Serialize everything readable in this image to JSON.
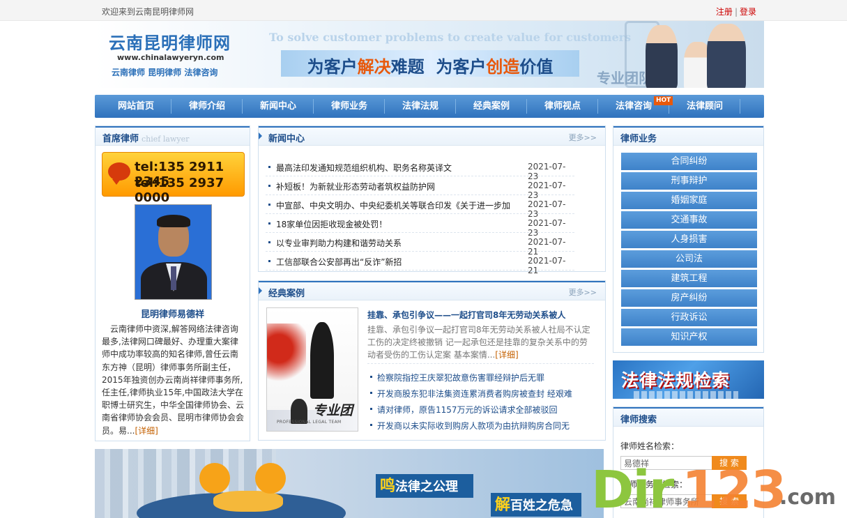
{
  "topbar": {
    "welcome": "欢迎来到云南昆明律师网",
    "register": "注册",
    "separator": "|",
    "login": "登录"
  },
  "banner": {
    "site_name": "云南昆明律师网",
    "site_url": "www.chinalawyeryn.com",
    "tags": "云南律师  昆明律师  法律咨询",
    "slogan_en": "To solve customer problems to create value for customers",
    "slogan_cn_parts": [
      "为客户",
      "解决",
      "难题",
      "为客户",
      "创造",
      "价值"
    ],
    "team_text": "专业团队"
  },
  "nav": {
    "items": [
      "网站首页",
      "律师介绍",
      "新闻中心",
      "律师业务",
      "法律法规",
      "经典案例",
      "律师视点",
      "法律咨询",
      "法律顾问"
    ],
    "hot_badge": "HOT"
  },
  "chief_lawyer": {
    "title": "首席律师",
    "subtitle": "chief lawyer",
    "phone1": "tel:135 2911 2345",
    "phone2": "tel:135 2937 0000",
    "name": "昆明律师易德祥",
    "bio": "云南律师中资深,解答网络法律咨询最多,法律网口碑最好、办理重大案律师中成功率较高的知名律师,曾任云南东方神（昆明）律师事务所副主任，2015年独资创办云南尚祥律师事务所,任主任,律师执业15年,中国政法大学在职博士研究生，中华全国律师协会、云南省律师协会会员、昆明市律师协会会员。易...",
    "detail_link": "[详细]"
  },
  "news": {
    "title": "新闻中心",
    "more": "更多>>",
    "items": [
      {
        "title": "最高法印发通知规范组织机构、职务名称英译文",
        "date": "2021-07-23"
      },
      {
        "title": "补短板！为新就业形态劳动者筑权益防护网",
        "date": "2021-07-23"
      },
      {
        "title": "中宣部、中央文明办、中央纪委机关等联合印发《关于进一步加",
        "date": "2021-07-23"
      },
      {
        "title": "18家单位因拒收现金被处罚！",
        "date": "2021-07-23"
      },
      {
        "title": "以专业审判助力构建和谐劳动关系",
        "date": "2021-07-21"
      },
      {
        "title": "工信部联合公安部再出“反诈”新招",
        "date": "2021-07-21"
      }
    ]
  },
  "cases": {
    "title": "经典案例",
    "more": "更多>>",
    "image_text": "专业团",
    "image_sub": "PROFESSIONAL LEGAL TEAM",
    "headline": "挂靠、承包引争议——一起打官司8年无劳动关系被人",
    "summary": "挂靠、承包引争议一起打官司8年无劳动关系被人社局不认定工伤的决定终被撤销 记一起承包还是挂靠的复杂关系中的劳动者受伤的工伤认定案 基本案情...",
    "detail_link": "[详细]",
    "items": [
      "检察院指控王庆翠犯故意伤害罪经辩护后无罪",
      "开发商股东犯非法集资连累消费者购房被查封 经艰难",
      "请对律师，原告1157万元的诉讼请求全部被驳回",
      "开发商以未实际收到购房人款项为由抗辩购房合同无"
    ]
  },
  "practice": {
    "title": "律师业务",
    "items": [
      "合同纠纷",
      "刑事辩护",
      "婚姻家庭",
      "交通事故",
      "人身损害",
      "公司法",
      "建筑工程",
      "房产纠纷",
      "行政诉讼",
      "知识产权"
    ]
  },
  "law_banner": {
    "text": "法律法规检索"
  },
  "search": {
    "title": "律师搜索",
    "name_label": "律师姓名检索：",
    "name_value": "易德祥",
    "button": "搜 索",
    "firm_label": "律师事务所检索：",
    "firm_value": "云南尚祥律师事务所"
  },
  "bottom_banner": {
    "box1_big": "鸣",
    "box1_text": "法律之公理",
    "box2_big": "解",
    "box2_text": "百姓之危急"
  },
  "watermark": {
    "dir": "Dir",
    "num": "123",
    "com": ".com"
  }
}
